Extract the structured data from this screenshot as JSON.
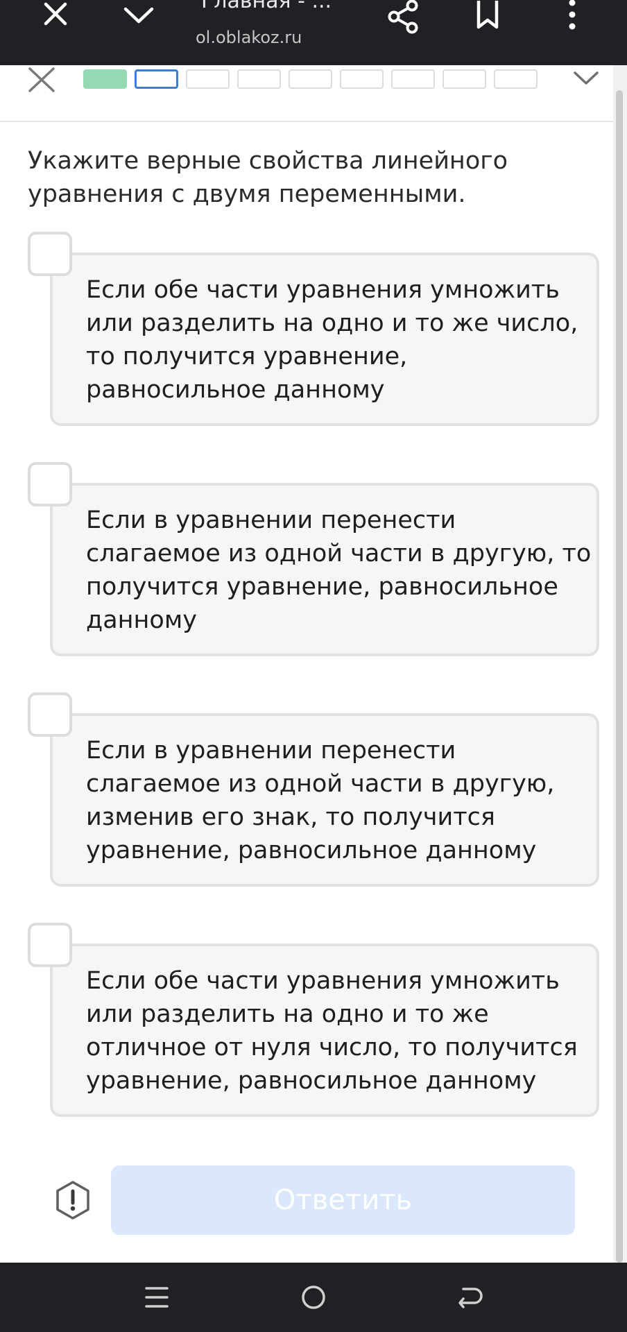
{
  "browser": {
    "title": "Главная - ...",
    "url": "ol.oblakoz.ru",
    "icons": [
      "close-icon",
      "chevron-down-icon",
      "share-icon",
      "bookmark-icon",
      "more-vertical-icon"
    ]
  },
  "progress": {
    "total_steps": 9,
    "completed_steps": 1,
    "current_step": 2,
    "colors": {
      "done": "#94d9b2",
      "current": "#3b7fd4",
      "pending": "#dcdcdc"
    }
  },
  "question": {
    "text": "Укажите верные свойства линейного уравнения с двумя переменными."
  },
  "options": [
    {
      "text": "Если обе части уравнения умножить или разделить на одно и то же число, то получится уравнение, равносильное данному",
      "checked": false
    },
    {
      "text": "Если в уравнении перенести слагаемое из одной части в другую, то получится уравнение, равносильное данному",
      "checked": false
    },
    {
      "text": "Если в уравнении перенести слагаемое из одной части в другую, изменив его знак, то получится уравнение, равносильное данному",
      "checked": false
    },
    {
      "text": "Если обе части уравнения умножить или разделить на одно и то же отличное от нуля число, то получится уравнение, равносильное данному",
      "checked": false
    }
  ],
  "footer": {
    "answer_label": "Ответить",
    "answer_color": "#dbe8fb",
    "hint_icon": "exclamation-hexagon-icon"
  },
  "system_nav": {
    "icons": [
      "menu-icon",
      "home-icon",
      "back-icon"
    ]
  }
}
